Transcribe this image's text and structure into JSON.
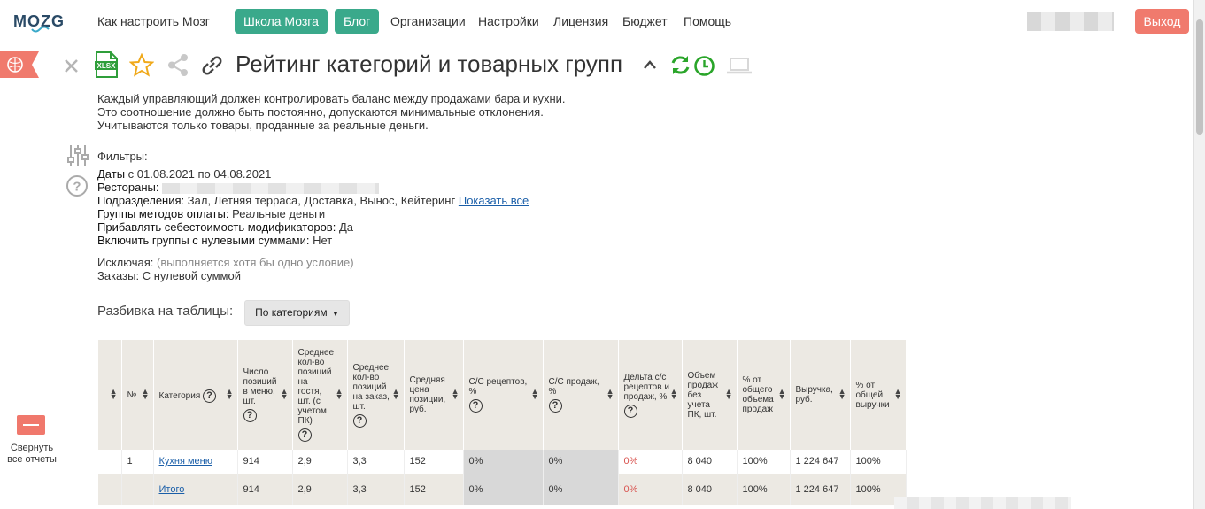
{
  "app": {
    "logo_text": "MOZG"
  },
  "nav": {
    "items": [
      "Как настроить Мозг",
      "Школа Мозга",
      "Блог",
      "Организации",
      "Настройки",
      "Лицензия",
      "Бюджет",
      "Помощь"
    ],
    "logout": "Выход"
  },
  "sidebar": {
    "collapse_label": "Свернуть все отчеты"
  },
  "toolbar": {
    "xlsx_label": "XLSX"
  },
  "report": {
    "title": "Рейтинг категорий и товарных групп",
    "description": [
      "Каждый управляющий должен контролировать баланс между продажами бара и кухни.",
      "Это соотношение должно быть постоянно, допускаются минимальные отклонения.",
      "Учитываются только товары, проданные за реальные деньги."
    ]
  },
  "filters": {
    "heading": "Фильтры:",
    "dates_label": "Даты",
    "dates_value": "с 01.08.2021 по 04.08.2021",
    "restaurants_label": "Рестораны:",
    "divisions_label": "Подразделения:",
    "divisions_value": "Зал, Летняя терраса, Доставка, Вынос, Кейтеринг",
    "show_all": "Показать все",
    "payment_label": "Группы методов оплаты:",
    "payment_value": "Реальные деньги",
    "modifiers_label": "Прибавлять себестоимость модификаторов:",
    "modifiers_value": "Да",
    "zero_label": "Включить группы с нулевыми суммами:",
    "zero_value": "Нет",
    "excluding_label": "Исключая:",
    "excluding_note": "(выполняется хотя бы одно условие)",
    "orders_label": "Заказы:",
    "orders_value": "С нулевой суммой"
  },
  "split": {
    "label": "Разбивка на таблицы:",
    "value": "По категориям"
  },
  "table": {
    "headers": [
      "",
      "№",
      "Категория",
      "Число позиций в меню, шт.",
      "Среднее кол-во позиций на гостя, шт. (с учетом ПК)",
      "Среднее кол-во позиций на заказ, шт.",
      "Средняя цена позиции, руб.",
      "С/С рецептов, %",
      "С/С продаж, %",
      "Дельта с/с рецептов и продаж, %",
      "Объем продаж без учета ПК, шт.",
      "% от общего объема продаж",
      "Выручка, руб.",
      "% от общей выручки"
    ],
    "rows": [
      [
        "",
        "1",
        "Кухня меню",
        "914",
        "2,9",
        "3,3",
        "152",
        "0%",
        "0%",
        "0%",
        "8 040",
        "100%",
        "1 224 647",
        "100%"
      ]
    ],
    "total": [
      "",
      "",
      "Итого",
      "914",
      "2,9",
      "3,3",
      "152",
      "0%",
      "0%",
      "0%",
      "8 040",
      "100%",
      "1 224 647",
      "100%"
    ]
  },
  "colors": {
    "accent": "#3aa98b",
    "danger": "#f07a6d",
    "refresh": "#2aa52a",
    "xlsx": "#2f9e3a",
    "star": "#f0a91b"
  }
}
